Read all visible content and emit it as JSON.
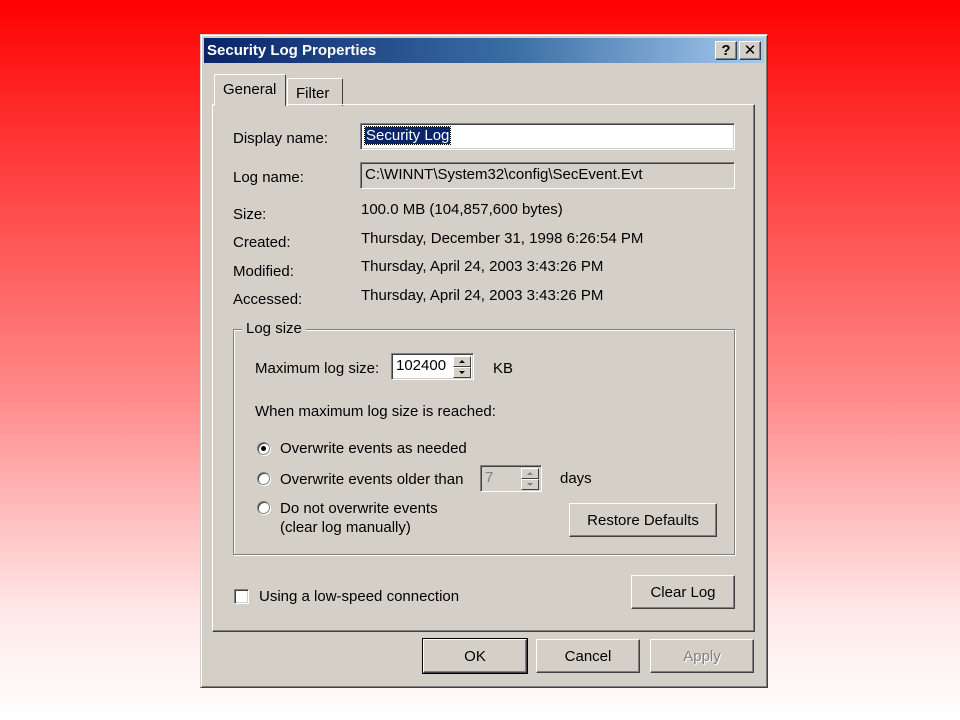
{
  "window": {
    "title": "Security Log Properties",
    "help_glyph": "?",
    "close_glyph": "✕"
  },
  "tabs": [
    {
      "label": "General",
      "active": true
    },
    {
      "label": "Filter",
      "active": false
    }
  ],
  "general": {
    "display_name_label": "Display name:",
    "display_name_value": "Security Log",
    "log_name_label": "Log name:",
    "log_name_value": "C:\\WINNT\\System32\\config\\SecEvent.Evt",
    "size_label": "Size:",
    "size_value": "100.0 MB (104,857,600 bytes)",
    "created_label": "Created:",
    "created_value": "Thursday, December 31, 1998 6:26:54 PM",
    "modified_label": "Modified:",
    "modified_value": "Thursday, April 24, 2003 3:43:26 PM",
    "accessed_label": "Accessed:",
    "accessed_value": "Thursday, April 24, 2003 3:43:26 PM"
  },
  "log_size": {
    "group_label": "Log size",
    "max_size_label": "Maximum log size:",
    "max_size_value": "102400",
    "max_size_unit": "KB",
    "when_reached_label": "When maximum log size is reached:",
    "options": [
      {
        "label": "Overwrite events as needed",
        "selected": true
      },
      {
        "label": "Overwrite events older than",
        "selected": false
      },
      {
        "label_line1": "Do not overwrite events",
        "label_line2": "(clear log manually)",
        "selected": false
      }
    ],
    "older_than_value": "7",
    "older_than_unit": "days",
    "restore_defaults_label": "Restore Defaults"
  },
  "low_speed_label": "Using a low-speed connection",
  "low_speed_checked": false,
  "clear_log_label": "Clear Log",
  "buttons": {
    "ok": "OK",
    "cancel": "Cancel",
    "apply": "Apply"
  }
}
